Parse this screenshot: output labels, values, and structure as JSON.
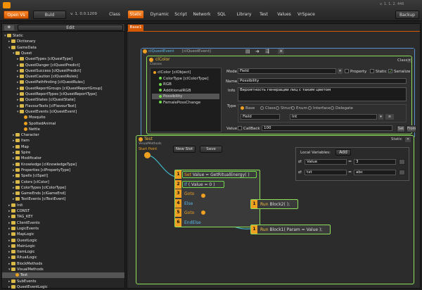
{
  "app": {
    "version": "v. 1. 1. 2. 446"
  },
  "toolbar": {
    "open_label": "Open Vs",
    "build_label": "Buld",
    "build_version": "v. 1. 0.0.1209",
    "backup_label": "Backup"
  },
  "tabs": [
    "Class",
    "Static",
    "Dynamic",
    "Script",
    "Network",
    "SQL",
    "Library",
    "Test",
    "Values",
    "VrSpace"
  ],
  "left_panel": {
    "edit_label": "Edit"
  },
  "tree": [
    {
      "label": "Static",
      "level": 0,
      "open": true
    },
    {
      "label": "Dictionary",
      "level": 1
    },
    {
      "label": "GameData",
      "level": 1,
      "open": true
    },
    {
      "label": "Quest",
      "level": 2,
      "open": true
    },
    {
      "label": "QuestTypes [clQuestType]",
      "level": 3
    },
    {
      "label": "QuestDanger [clQuestPredict]",
      "level": 3
    },
    {
      "label": "QuestSuccess [clQuestPredict]",
      "level": 3
    },
    {
      "label": "QuestCaution [clQuestRules]",
      "level": 3
    },
    {
      "label": "QuestPathfinding [clQuestRules]",
      "level": 3
    },
    {
      "label": "QuestReportGroups [clQuestReportGroup]",
      "level": 3
    },
    {
      "label": "QuestReportTypes [clQuestReportType]",
      "level": 3
    },
    {
      "label": "QuestStates [clQuestState]",
      "level": 3
    },
    {
      "label": "FlavourTexts [clFlavourText]",
      "level": 3
    },
    {
      "label": "QuestEvents [clQuestEvent]",
      "level": 3,
      "open": true
    },
    {
      "label": "Mosquito",
      "level": 4,
      "dot": true
    },
    {
      "label": "SpottedAnimal",
      "level": 4,
      "dot": true
    },
    {
      "label": "Nettle",
      "level": 4,
      "dot": true
    },
    {
      "label": "Character",
      "level": 2
    },
    {
      "label": "Item",
      "level": 2
    },
    {
      "label": "Map",
      "level": 2
    },
    {
      "label": "Spire",
      "level": 2
    },
    {
      "label": "Modificator",
      "level": 2
    },
    {
      "label": "Knowledge [clKnowledgeType]",
      "level": 2
    },
    {
      "label": "Properties [clPropertyType]",
      "level": 2
    },
    {
      "label": "Spells [clSpell]",
      "level": 2
    },
    {
      "label": "Colors [clColor]",
      "level": 2
    },
    {
      "label": "ColorTypes [clColorType]",
      "level": 2
    },
    {
      "label": "GameEnds [clGameEnd]",
      "level": 2
    },
    {
      "label": "TextEvents [clTextEvent]",
      "level": 2
    },
    {
      "label": "Init",
      "level": 1
    },
    {
      "label": "CONST",
      "level": 1
    },
    {
      "label": "TAG_KEY",
      "level": 1
    },
    {
      "label": "ClientEvents",
      "level": 1
    },
    {
      "label": "LogicEvents",
      "level": 1
    },
    {
      "label": "MapLogic",
      "level": 1
    },
    {
      "label": "QuestLogic",
      "level": 1
    },
    {
      "label": "MainLogic",
      "level": 1
    },
    {
      "label": "ItemLogic",
      "level": 1
    },
    {
      "label": "RitualLogic",
      "level": 1
    },
    {
      "label": "BlockMethods",
      "level": 1
    },
    {
      "label": "VisualMethods",
      "level": 1,
      "open": true
    },
    {
      "label": "Test",
      "level": 2,
      "dot": true,
      "selected": true
    },
    {
      "label": "SubEvents",
      "level": 1
    },
    {
      "label": "QuestEventLogic",
      "level": 1
    }
  ],
  "doc_tab": "Base1",
  "class_panel": {
    "title": "clQuestEvent",
    "subtitle": "[clQuestEvent]",
    "class_label": "Class",
    "color_title": "clColor",
    "color_sub": "Classes",
    "members": [
      "clColor [clObject]",
      "ColorType [clColorType]",
      "RGB",
      "AdditionalRGB",
      "Possibility",
      "FemalePossChange"
    ],
    "mode_label": "Mode",
    "mode_value": "Field",
    "property_label": "Property",
    "static_label": "Static",
    "serialize_label": "Serialize",
    "name_label": "Name",
    "name_value": "Possibility",
    "info_label": "Info",
    "info_value": "Вероятность генерации лиц с таким цветом",
    "type_label": "Type",
    "type_options": [
      "Base",
      "Class",
      "Struct",
      "Enum",
      "Interface",
      "Delegate"
    ],
    "type_kind": "Field",
    "type_value": "Int",
    "value_label": "Value",
    "callback_label": "CallBack",
    "value_value": "100",
    "set_label": "Set",
    "from_label": "From"
  },
  "visual": {
    "title": "Test",
    "subtitle": "VisualMethods",
    "static_label": "Static",
    "start_label": "Start Point",
    "new_slot": "New Slot",
    "save": "Save",
    "locals_label": "Local Variables:",
    "add_label": "Add",
    "vars": [
      {
        "name": "Value",
        "value": "3"
      },
      {
        "name": "txt",
        "value": "abc"
      }
    ],
    "lines": [
      {
        "num": "1",
        "kw": "Set",
        "rest": "Value = GetRitualEnergy(  )"
      },
      {
        "num": "2",
        "kw": "If",
        "rest": "( Value = 0 )"
      },
      {
        "num": "3",
        "kw": "Goto",
        "rest": ""
      },
      {
        "num": "4",
        "kw": "Else",
        "rest": ""
      },
      {
        "num": "5",
        "kw": "Goto",
        "rest": ""
      },
      {
        "num": "6",
        "kw": "EndElse",
        "rest": ""
      }
    ],
    "block2": {
      "num": "1",
      "kw": "Run",
      "rest": "Block2(  );"
    },
    "block1": {
      "num": "1",
      "kw": "Run",
      "rest": "Block1( Param = Value );"
    }
  }
}
